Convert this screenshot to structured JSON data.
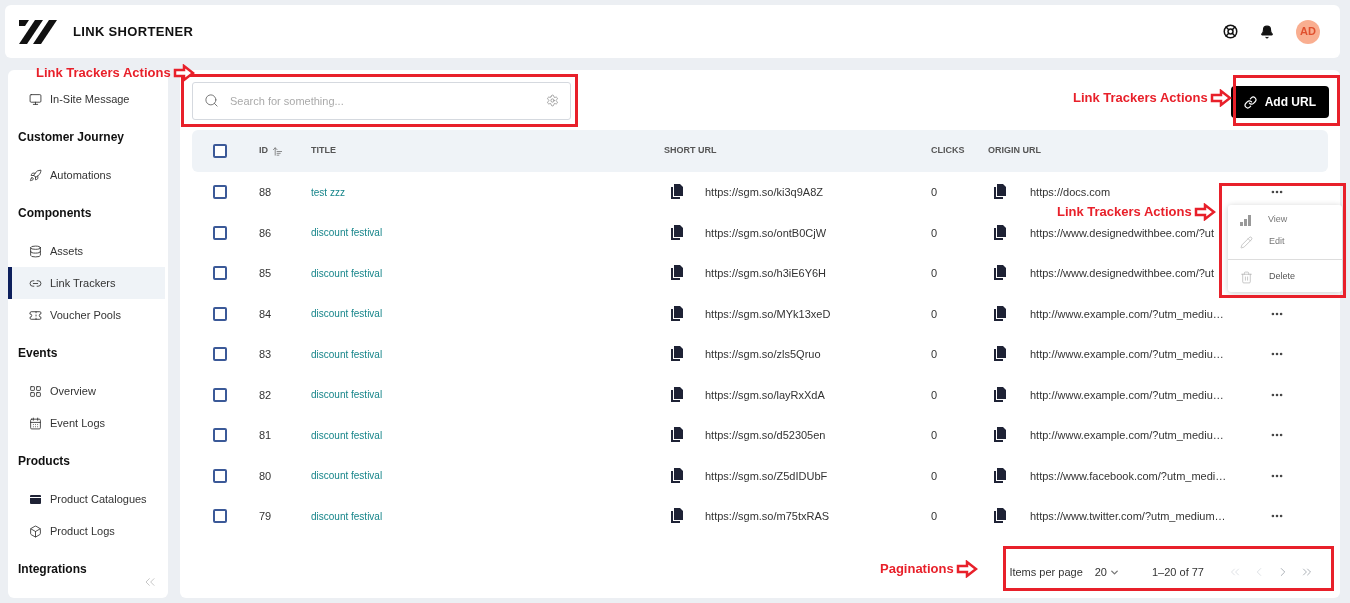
{
  "header": {
    "title": "LINK SHORTENER",
    "avatar": "AD"
  },
  "sidebar": {
    "sections": [
      {
        "items": [
          {
            "label": "In-Site Message",
            "selected": false
          }
        ]
      },
      {
        "heading": "Customer Journey",
        "items": [
          {
            "label": "Automations",
            "selected": false
          }
        ]
      },
      {
        "heading": "Components",
        "items": [
          {
            "label": "Assets",
            "selected": false
          },
          {
            "label": "Link Trackers",
            "selected": true
          },
          {
            "label": "Voucher Pools",
            "selected": false
          }
        ]
      },
      {
        "heading": "Events",
        "items": [
          {
            "label": "Overview",
            "selected": false
          },
          {
            "label": "Event Logs",
            "selected": false
          }
        ]
      },
      {
        "heading": "Products",
        "items": [
          {
            "label": "Product Catalogues",
            "selected": false
          },
          {
            "label": "Product Logs",
            "selected": false
          }
        ]
      },
      {
        "heading": "Integrations"
      }
    ]
  },
  "search": {
    "placeholder": "Search for something...",
    "annotation": "Link Trackers Actions"
  },
  "add_button": {
    "label": "Add URL",
    "annotation": "Link Trackers Actions"
  },
  "table": {
    "header_checked": false,
    "columns": [
      "ID",
      "TITLE",
      "SHORT URL",
      "CLICKS",
      "ORIGIN URL"
    ],
    "rows": [
      {
        "id": "88",
        "title": "test zzz",
        "short_url": "https://sgm.so/ki3q9A8Z",
        "clicks": "0",
        "origin_url": "https://docs.com",
        "checked": false
      },
      {
        "id": "86",
        "title": "discount festival",
        "short_url": "https://sgm.so/ontB0CjW",
        "clicks": "0",
        "origin_url": "https://www.designedwithbee.com/?ut",
        "checked": false
      },
      {
        "id": "85",
        "title": "discount festival",
        "short_url": "https://sgm.so/h3iE6Y6H",
        "clicks": "0",
        "origin_url": "https://www.designedwithbee.com/?ut",
        "checked": false
      },
      {
        "id": "84",
        "title": "discount festival",
        "short_url": "https://sgm.so/MYk13xeD",
        "clicks": "0",
        "origin_url": "http://www.example.com/?utm_mediu…",
        "checked": false
      },
      {
        "id": "83",
        "title": "discount festival",
        "short_url": "https://sgm.so/zls5Qruo",
        "clicks": "0",
        "origin_url": "http://www.example.com/?utm_mediu…",
        "checked": false
      },
      {
        "id": "82",
        "title": "discount festival",
        "short_url": "https://sgm.so/layRxXdA",
        "clicks": "0",
        "origin_url": "http://www.example.com/?utm_mediu…",
        "checked": false
      },
      {
        "id": "81",
        "title": "discount festival",
        "short_url": "https://sgm.so/d52305en",
        "clicks": "0",
        "origin_url": "http://www.example.com/?utm_mediu…",
        "checked": false
      },
      {
        "id": "80",
        "title": "discount festival",
        "short_url": "https://sgm.so/Z5dIDUbF",
        "clicks": "0",
        "origin_url": "https://www.facebook.com/?utm_medi…",
        "checked": false
      },
      {
        "id": "79",
        "title": "discount festival",
        "short_url": "https://sgm.so/m75txRAS",
        "clicks": "0",
        "origin_url": "https://www.twitter.com/?utm_medium…",
        "checked": false
      }
    ]
  },
  "row_menu": {
    "annotation": "Link Trackers Actions",
    "items": [
      {
        "label": "View",
        "kind": "view"
      },
      {
        "label": "Edit",
        "kind": "edit"
      },
      {
        "label": "Delete",
        "kind": "delete"
      }
    ]
  },
  "pagination": {
    "annotation": "Paginations",
    "items_per_page_label": "Items per page",
    "page_size": "20",
    "range": "1–20 of 77",
    "buttons": [
      {
        "kind": "first",
        "disabled": true
      },
      {
        "kind": "prev",
        "disabled": true
      },
      {
        "kind": "next",
        "disabled": false
      },
      {
        "kind": "last",
        "disabled": false
      }
    ]
  }
}
